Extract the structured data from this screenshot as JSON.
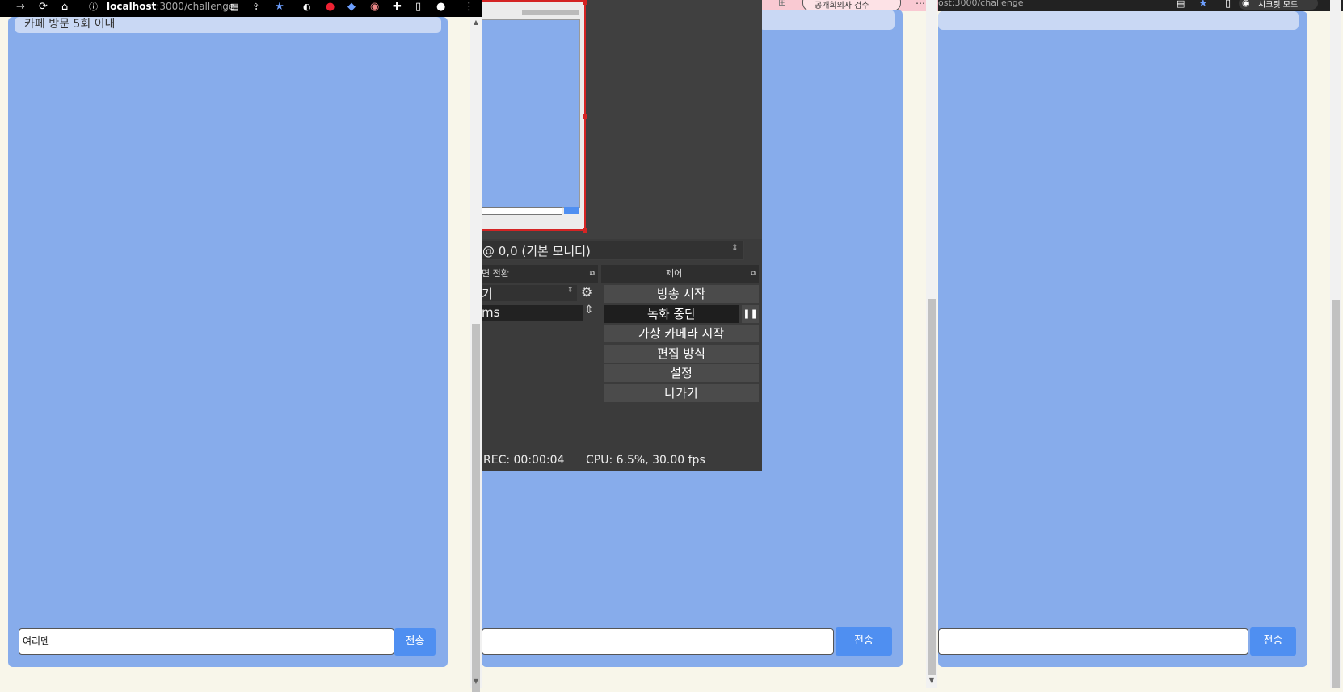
{
  "browser1": {
    "url": "localhost:3000/challenge",
    "url_host": "localhost",
    "url_path": ":3000/challenge"
  },
  "browser3": {
    "url_fragment": "ost:3000/challenge",
    "profile_label": "시크릿 모드"
  },
  "meeting_tab": {
    "label": "공개회의사 검수"
  },
  "panel1": {
    "top_card_text": "카페 방문 5회 이내",
    "input_value": "여리멘",
    "send_label": "전송"
  },
  "panel2": {
    "send_label": "전송"
  },
  "panel3": {
    "send_label": "전송"
  },
  "obs": {
    "monitor_select": "@ 0,0 (기본 모니터)",
    "transitions_title": "면 전환",
    "controls_title": "제어",
    "transition_value": "기",
    "duration_value": "ms",
    "buttons": {
      "start_stream": "방송 시작",
      "stop_recording": "녹화 중단",
      "virtual_camera": "가상 카메라 시작",
      "studio_mode": "편집 방식",
      "settings": "설정",
      "exit": "나가기"
    },
    "status": {
      "rec": "REC: 00:00:04",
      "cpu": "CPU: 6.5%, 30.00 fps"
    }
  },
  "colors": {
    "panel": "#87aceb",
    "obs_bg": "#3b3b3b",
    "send": "#4f8ff1",
    "preview_border": "#d42424"
  }
}
